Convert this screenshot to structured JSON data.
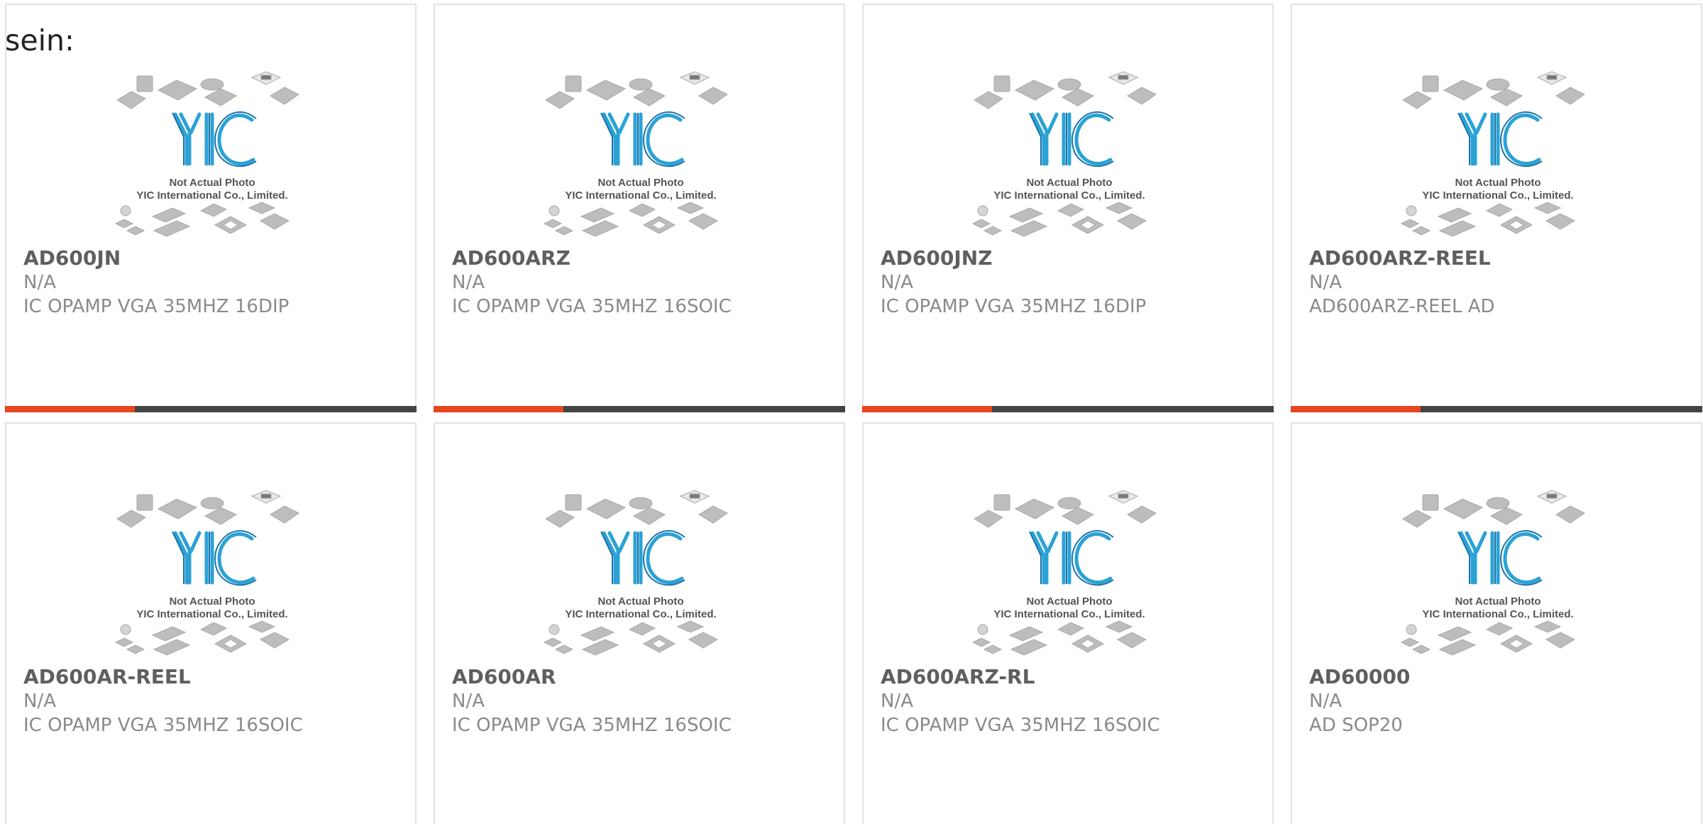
{
  "intro_text": "sein:",
  "colors": {
    "accent": "#e8461e",
    "bar_dark": "#444444",
    "logo_blue": "#2aa2d6",
    "chip_gray": "#bdbdbd"
  },
  "placeholder": {
    "line1": "Not Actual Photo",
    "line2": "YIC International Co., Limited.",
    "logo": "YIC"
  },
  "products": [
    {
      "part": "AD600JN",
      "maker": "N/A",
      "desc": "IC OPAMP VGA 35MHZ 16DIP"
    },
    {
      "part": "AD600ARZ",
      "maker": "N/A",
      "desc": "IC OPAMP VGA 35MHZ 16SOIC"
    },
    {
      "part": "AD600JNZ",
      "maker": "N/A",
      "desc": "IC OPAMP VGA 35MHZ 16DIP"
    },
    {
      "part": "AD600ARZ-REEL",
      "maker": "N/A",
      "desc": "AD600ARZ-REEL AD"
    },
    {
      "part": "AD600AR-REEL",
      "maker": "N/A",
      "desc": "IC OPAMP VGA 35MHZ 16SOIC"
    },
    {
      "part": "AD600AR",
      "maker": "N/A",
      "desc": "IC OPAMP VGA 35MHZ 16SOIC"
    },
    {
      "part": "AD600ARZ-RL",
      "maker": "N/A",
      "desc": "IC OPAMP VGA 35MHZ 16SOIC"
    },
    {
      "part": "AD60000",
      "maker": "N/A",
      "desc": "AD SOP20"
    }
  ]
}
